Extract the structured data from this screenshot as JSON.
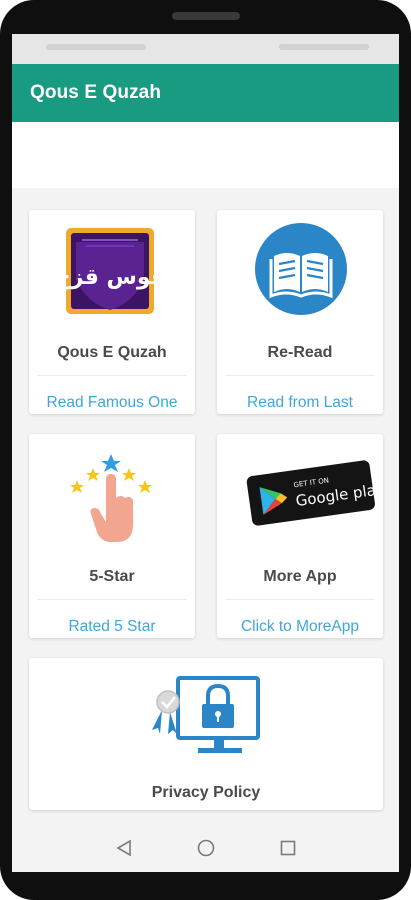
{
  "app": {
    "title": "Qous E Quzah"
  },
  "cards": [
    {
      "title": "Qous E Quzah",
      "link": "Read Famous One",
      "icon": "qous-e-quzah-logo-icon",
      "logo_text": "قوس قزح"
    },
    {
      "title": "Re-Read",
      "link": "Read from Last",
      "icon": "open-book-icon"
    },
    {
      "title": "5-Star",
      "link": "Rated 5 Star",
      "icon": "five-star-rating-icon"
    },
    {
      "title": "More App",
      "link": "Click to MoreApp",
      "icon": "google-play-badge-icon",
      "badge_small": "GET IT ON",
      "badge_large": "Google play"
    },
    {
      "title": "Privacy Policy",
      "icon": "privacy-lock-icon"
    }
  ],
  "colors": {
    "app_bar": "#199b82",
    "link": "#3ea6dc",
    "title_text": "#4a4a4a",
    "book_circle": "#2b86c8"
  },
  "nav": {
    "back": "back-icon",
    "home": "home-icon",
    "recent": "recent-apps-icon"
  }
}
